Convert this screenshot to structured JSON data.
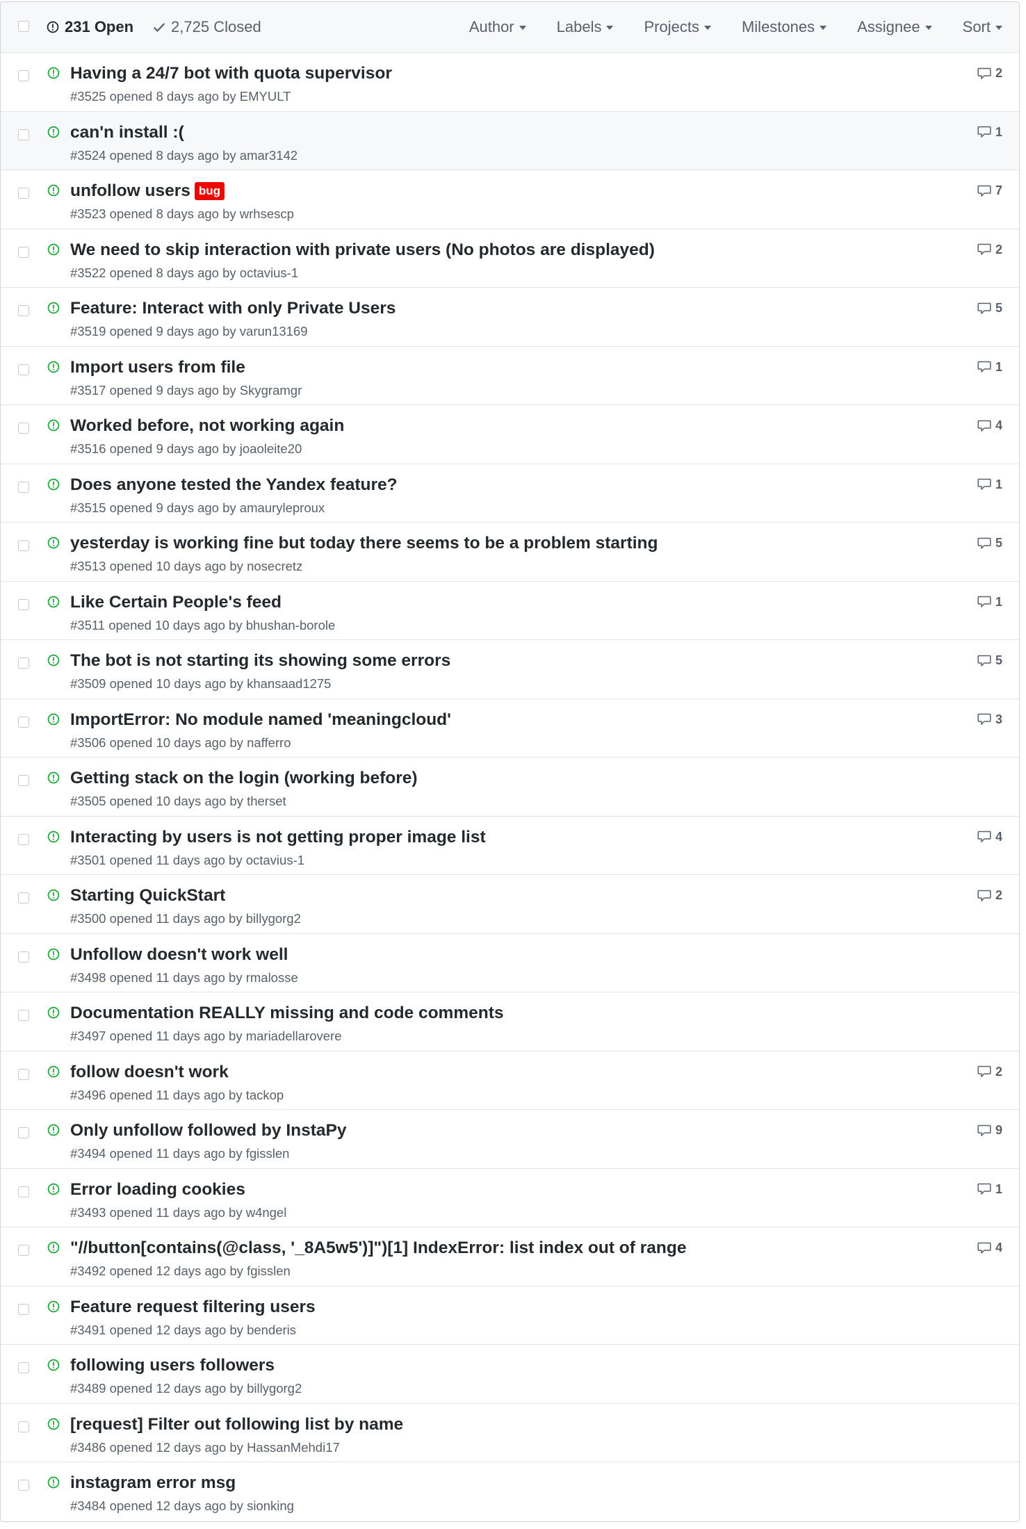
{
  "header": {
    "open_count": "231 Open",
    "closed_count": "2,725 Closed",
    "filters": [
      "Author",
      "Labels",
      "Projects",
      "Milestones",
      "Assignee",
      "Sort"
    ]
  },
  "colors": {
    "open_icon": "#28a745",
    "bug_label": "#ee0701"
  },
  "issues": [
    {
      "title": "Having a 24/7 bot with quota supervisor",
      "meta": "#3525 opened 8 days ago by EMYULT",
      "comments": "2"
    },
    {
      "title": "can'n install :(",
      "meta": "#3524 opened 8 days ago by amar3142",
      "comments": "1"
    },
    {
      "title": "unfollow users",
      "label": "bug",
      "meta": "#3523 opened 8 days ago by wrhsescp",
      "comments": "7"
    },
    {
      "title": "We need to skip interaction with private users (No photos are displayed)",
      "meta": "#3522 opened 8 days ago by octavius-1",
      "comments": "2"
    },
    {
      "title": "Feature: Interact with only Private Users",
      "meta": "#3519 opened 9 days ago by varun13169",
      "comments": "5"
    },
    {
      "title": "Import users from file",
      "meta": "#3517 opened 9 days ago by Skygramgr",
      "comments": "1"
    },
    {
      "title": "Worked before, not working again",
      "meta": "#3516 opened 9 days ago by joaoleite20",
      "comments": "4"
    },
    {
      "title": "Does anyone tested the Yandex feature?",
      "meta": "#3515 opened 9 days ago by amauryleproux",
      "comments": "1"
    },
    {
      "title": "yesterday is working fine but today there seems to be a problem starting",
      "meta": "#3513 opened 10 days ago by nosecretz",
      "comments": "5"
    },
    {
      "title": "Like Certain People's feed",
      "meta": "#3511 opened 10 days ago by bhushan-borole",
      "comments": "1"
    },
    {
      "title": "The bot is not starting its showing some errors",
      "meta": "#3509 opened 10 days ago by khansaad1275",
      "comments": "5"
    },
    {
      "title": "ImportError: No module named 'meaningcloud'",
      "meta": "#3506 opened 10 days ago by nafferro",
      "comments": "3"
    },
    {
      "title": "Getting stack on the login (working before)",
      "meta": "#3505 opened 10 days ago by therset",
      "comments": ""
    },
    {
      "title": "Interacting by users is not getting proper image list",
      "meta": "#3501 opened 11 days ago by octavius-1",
      "comments": "4"
    },
    {
      "title": "Starting QuickStart",
      "meta": "#3500 opened 11 days ago by billygorg2",
      "comments": "2"
    },
    {
      "title": "Unfollow doesn't work well",
      "meta": "#3498 opened 11 days ago by rmalosse",
      "comments": ""
    },
    {
      "title": "Documentation REALLY missing and code comments",
      "meta": "#3497 opened 11 days ago by mariadellarovere",
      "comments": ""
    },
    {
      "title": "follow doesn't work",
      "meta": "#3496 opened 11 days ago by tackop",
      "comments": "2"
    },
    {
      "title": "Only unfollow followed by InstaPy",
      "meta": "#3494 opened 11 days ago by fgisslen",
      "comments": "9"
    },
    {
      "title": "Error loading cookies",
      "meta": "#3493 opened 11 days ago by w4ngel",
      "comments": "1"
    },
    {
      "title": "\"//button[contains(@class, '_8A5w5')]\")[1] IndexError: list index out of range",
      "meta": "#3492 opened 12 days ago by fgisslen",
      "comments": "4"
    },
    {
      "title": "Feature request filtering users",
      "meta": "#3491 opened 12 days ago by benderis",
      "comments": ""
    },
    {
      "title": "following users followers",
      "meta": "#3489 opened 12 days ago by billygorg2",
      "comments": ""
    },
    {
      "title": "[request] Filter out following list by name",
      "meta": "#3486 opened 12 days ago by HassanMehdi17",
      "comments": ""
    },
    {
      "title": "instagram error msg",
      "meta": "#3484 opened 12 days ago by sionking",
      "comments": ""
    }
  ]
}
